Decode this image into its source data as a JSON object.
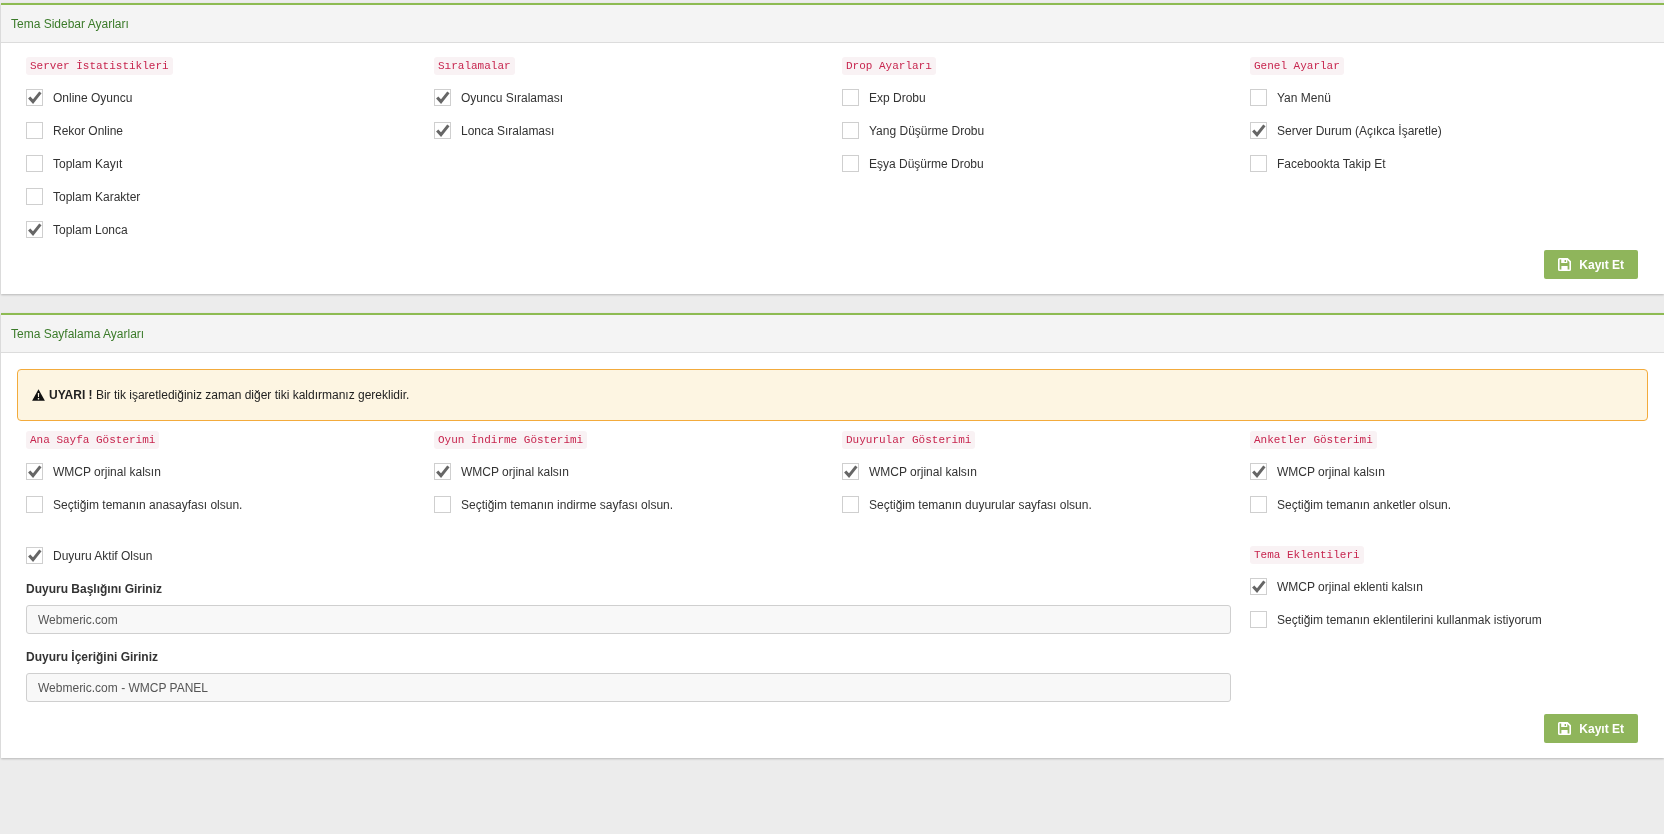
{
  "sidebar_panel": {
    "title": "Tema Sidebar Ayarları",
    "groups": [
      {
        "title": "Server İstatistikleri",
        "options": [
          {
            "label": "Online Oyuncu",
            "checked": true
          },
          {
            "label": "Rekor Online",
            "checked": false
          },
          {
            "label": "Toplam Kayıt",
            "checked": false
          },
          {
            "label": "Toplam Karakter",
            "checked": false
          },
          {
            "label": "Toplam Lonca",
            "checked": true
          }
        ]
      },
      {
        "title": "Sıralamalar",
        "options": [
          {
            "label": "Oyuncu Sıralaması",
            "checked": true
          },
          {
            "label": "Lonca Sıralaması",
            "checked": true
          }
        ]
      },
      {
        "title": "Drop Ayarları",
        "options": [
          {
            "label": "Exp Drobu",
            "checked": false
          },
          {
            "label": "Yang Düşürme Drobu",
            "checked": false
          },
          {
            "label": "Eşya Düşürme Drobu",
            "checked": false
          }
        ]
      },
      {
        "title": "Genel Ayarlar",
        "options": [
          {
            "label": "Yan Menü",
            "checked": false
          },
          {
            "label": "Server Durum (Açıkca İşaretle)",
            "checked": true
          },
          {
            "label": "Facebookta Takip Et",
            "checked": false
          }
        ]
      }
    ],
    "save_button": "Kayıt Et"
  },
  "paging_panel": {
    "title": "Tema Sayfalama Ayarları",
    "warning": "**UYARI !** Bir tik işaretlediğiniz zaman diğer tiki kaldırmanız gereklidir.",
    "groups": [
      {
        "title": "Ana Sayfa Gösterimi",
        "options": [
          {
            "label": "WMCP orjinal kalsın",
            "checked": true
          },
          {
            "label": "Seçtiğim temanın anasayfası olsun.",
            "checked": false
          }
        ]
      },
      {
        "title": "Oyun İndirme Gösterimi",
        "options": [
          {
            "label": "WMCP orjinal kalsın",
            "checked": true
          },
          {
            "label": "Seçtiğim temanın indirme sayfası olsun.",
            "checked": false
          }
        ]
      },
      {
        "title": "Duyurular Gösterimi",
        "options": [
          {
            "label": "WMCP orjinal kalsın",
            "checked": true
          },
          {
            "label": "Seçtiğim temanın duyurular sayfası olsun.",
            "checked": false
          }
        ]
      },
      {
        "title": "Anketler Gösterimi",
        "options": [
          {
            "label": "WMCP orjinal kalsın",
            "checked": true
          },
          {
            "label": "Seçtiğim temanın anketler olsun.",
            "checked": false
          }
        ]
      }
    ],
    "announcement": {
      "toggle": {
        "label": "Duyuru Aktif Olsun",
        "checked": true
      },
      "fields": [
        {
          "label": "Duyuru Başlığını Giriniz",
          "value": "Webmeric.com"
        },
        {
          "label": "Duyuru İçeriğini Giriniz",
          "value": "Webmeric.com - WMCP PANEL"
        }
      ]
    },
    "extensions": {
      "title": "Tema Eklentileri",
      "options": [
        {
          "label": "WMCP orjinal eklenti kalsın",
          "checked": true
        },
        {
          "label": "Seçtiğim temanın eklentilerini kullanmak istiyorum",
          "checked": false
        }
      ]
    },
    "save_button": "Kayıt Et"
  }
}
